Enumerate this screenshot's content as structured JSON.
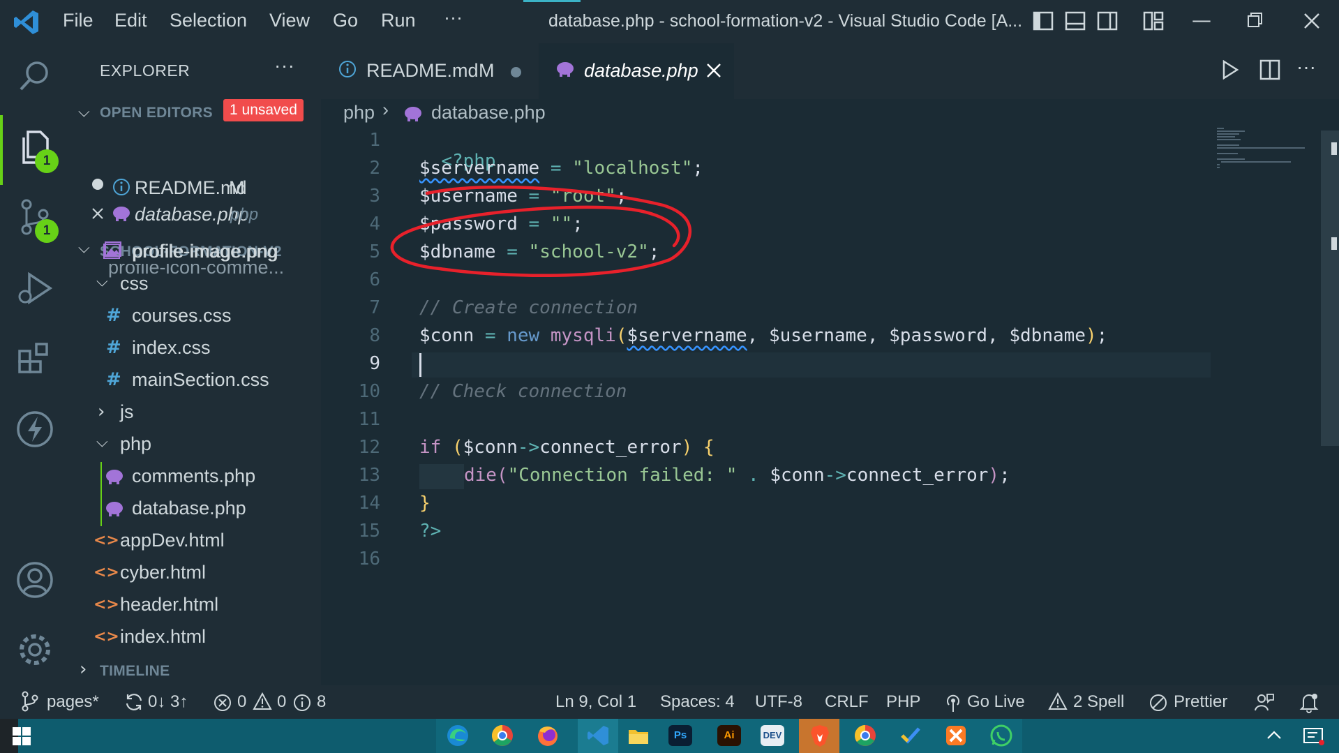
{
  "titlebar": {
    "menu": [
      "File",
      "Edit",
      "Selection",
      "View",
      "Go",
      "Run",
      "···"
    ],
    "title": "database.php - school-formation-v2 - Visual Studio Code [A..."
  },
  "activity_badges": {
    "explorer": "1",
    "scm": "1"
  },
  "sidebar": {
    "header": "EXPLORER",
    "more": "···",
    "open_editors_label": "OPEN EDITORS",
    "unsaved_badge": "1 unsaved",
    "open_editors": [
      {
        "name": "README.md",
        "status": "M"
      },
      {
        "name": "database.php",
        "status": "php"
      }
    ],
    "project_label": "SCHOOL-FORMATION-V2",
    "tree": [
      {
        "label": "profile-icon-comme..."
      },
      {
        "label": "profile-image.png"
      },
      {
        "label": "css"
      },
      {
        "label": "courses.css"
      },
      {
        "label": "index.css"
      },
      {
        "label": "mainSection.css"
      },
      {
        "label": "js"
      },
      {
        "label": "php"
      },
      {
        "label": "comments.php"
      },
      {
        "label": "database.php"
      },
      {
        "label": "appDev.html"
      },
      {
        "label": "cyber.html"
      },
      {
        "label": "header.html"
      },
      {
        "label": "index.html"
      }
    ],
    "timeline_label": "TIMELINE"
  },
  "tabs": [
    {
      "label": "README.md",
      "status": "M"
    },
    {
      "label": "database.php"
    }
  ],
  "breadcrumb": {
    "folder": "php",
    "file": "database.php"
  },
  "editor": {
    "line_numbers": [
      "1",
      "2",
      "3",
      "4",
      "5",
      "6",
      "7",
      "8",
      "9",
      "10",
      "11",
      "12",
      "13",
      "14",
      "15",
      "16"
    ],
    "active_line": "9",
    "tokens": {
      "l1_open": "<?php",
      "l2_var": "$servername",
      "l2_eq": " = ",
      "l2_str": "\"localhost\"",
      "l2_semi": ";",
      "l3_var": "$username",
      "l3_eq": " = ",
      "l3_str": "\"root\"",
      "l3_semi": ";",
      "l4_var": "$password",
      "l4_eq": " = ",
      "l4_str": "\"\"",
      "l4_semi": ";",
      "l5_var": "$dbname",
      "l5_eq": " = ",
      "l5_str": "\"school-v2\"",
      "l5_semi": ";",
      "l7_com": "// Create connection",
      "l8_var": "$conn",
      "l8_eq": " = ",
      "l8_new": "new",
      "l8_cls": " mysqli",
      "l8_p1": "(",
      "l8_a1": "$servername",
      "l8_c1": ", ",
      "l8_a2": "$username",
      "l8_c2": ", ",
      "l8_a3": "$password",
      "l8_c3": ", ",
      "l8_a4": "$dbname",
      "l8_p2": ")",
      "l8_semi": ";",
      "l10_com": "// Check connection",
      "l12_if": "if",
      "l12_sp": " ",
      "l12_p1": "(",
      "l12_var": "$conn",
      "l12_arrow": "->",
      "l12_prop": "connect_error",
      "l12_p2": ")",
      "l12_sp2": " ",
      "l12_brace": "{",
      "l13_die": "die",
      "l13_p1": "(",
      "l13_str": "\"Connection failed: \"",
      "l13_dot": " . ",
      "l13_var": "$conn",
      "l13_arrow": "->",
      "l13_prop": "connect_error",
      "l13_p2": ")",
      "l13_semi": ";",
      "l14_brace": "}",
      "l15_close": "?>"
    }
  },
  "statusbar": {
    "branch": "pages*",
    "sync": "0↓ 3↑",
    "errors": "0",
    "warnings": "0",
    "infos": "8",
    "position": "Ln 9, Col 1",
    "spaces": "Spaces: 4",
    "encoding": "UTF-8",
    "eol": "CRLF",
    "language": "PHP",
    "golive": "Go Live",
    "spell": "2 Spell",
    "prettier": "Prettier"
  },
  "taskbar": {
    "apps": [
      "edge-icon",
      "chrome-icon",
      "firefox-icon",
      "vscode-icon",
      "file-explorer-icon",
      "photoshop-icon",
      "illustrator-icon",
      "devcx-icon",
      "brave-icon",
      "chrome-profile-icon",
      "todo-icon",
      "xampp-icon",
      "whatsapp-icon"
    ],
    "app_labels": {
      "photoshop": "Ps",
      "illustrator": "Ai",
      "devcx": "DEV"
    }
  },
  "colors": {
    "background": "#1b2b34",
    "panel": "#1f2d36",
    "accent_green": "#67d117",
    "annotation_red": "#e8212b",
    "taskbar": "#0e5c6e"
  }
}
